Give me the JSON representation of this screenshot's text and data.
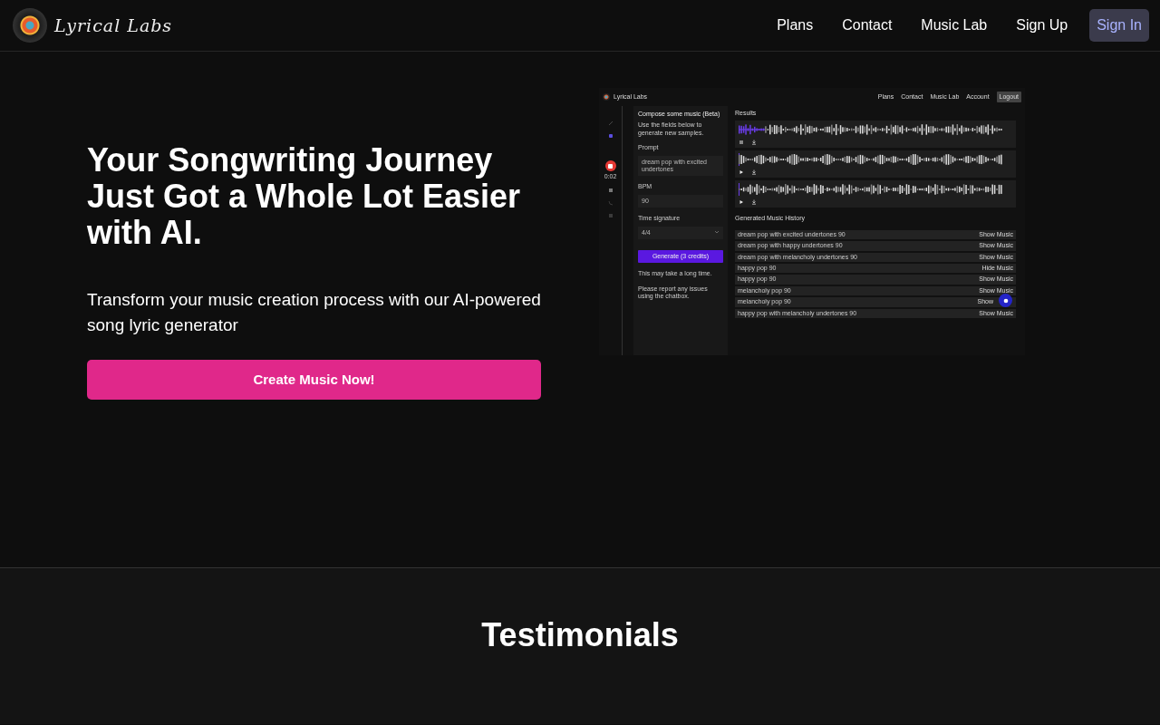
{
  "brand": {
    "name": "Lyrical Labs"
  },
  "nav": [
    {
      "label": "Plans",
      "kind": "link"
    },
    {
      "label": "Contact",
      "kind": "link"
    },
    {
      "label": "Music Lab",
      "kind": "link"
    },
    {
      "label": "Sign Up",
      "kind": "link"
    },
    {
      "label": "Sign In",
      "kind": "button"
    }
  ],
  "hero": {
    "title": "Your Songwriting Journey Just Got a Whole Lot Easier with AI.",
    "subtitle": "Transform your music creation process with our AI-powered song lyric generator",
    "cta": "Create Music Now!"
  },
  "preview": {
    "brand": "Lyrical Labs",
    "nav": [
      {
        "label": "Plans",
        "kind": "link"
      },
      {
        "label": "Contact",
        "kind": "link"
      },
      {
        "label": "Music Lab",
        "kind": "link"
      },
      {
        "label": "Account",
        "kind": "link"
      },
      {
        "label": "Logout",
        "kind": "button"
      }
    ],
    "recorder": {
      "time": "0:02"
    },
    "form": {
      "title": "Compose some music (Beta)",
      "intro": "Use the fields below to generate new samples.",
      "fields": [
        {
          "label": "Prompt",
          "value": "dream pop with excited undertones",
          "kind": "text"
        },
        {
          "label": "BPM",
          "value": "90",
          "kind": "text"
        },
        {
          "label": "Time signature",
          "value": "4/4",
          "kind": "select"
        }
      ],
      "button": "Generate (3 credits)",
      "notes": [
        "This may take a long time.",
        "Please report any issues using the chatbox."
      ]
    },
    "results": {
      "title": "Results",
      "players": [
        {
          "playing": true,
          "level": 0.1
        },
        {
          "playing": false,
          "level": 0
        },
        {
          "playing": false,
          "level": 0
        }
      ]
    },
    "history": {
      "title": "Generated Music History",
      "rows": [
        {
          "name": "dream pop with excited undertones 90",
          "action": "Show Music"
        },
        {
          "name": "dream pop with happy undertones 90",
          "action": "Show Music"
        },
        {
          "name": "dream pop with melancholy undertones 90",
          "action": "Show Music"
        },
        {
          "name": "happy pop 90",
          "action": "Hide Music"
        },
        {
          "name": "happy pop 90",
          "action": "Show Music"
        },
        {
          "name": "melancholy pop 90",
          "action": "Show Music"
        },
        {
          "name": "melancholy pop 90",
          "action": "Show"
        },
        {
          "name": "happy pop with melancholy undertones 90",
          "action": "Show Music"
        }
      ]
    }
  },
  "testimonials": {
    "title": "Testimonials"
  }
}
